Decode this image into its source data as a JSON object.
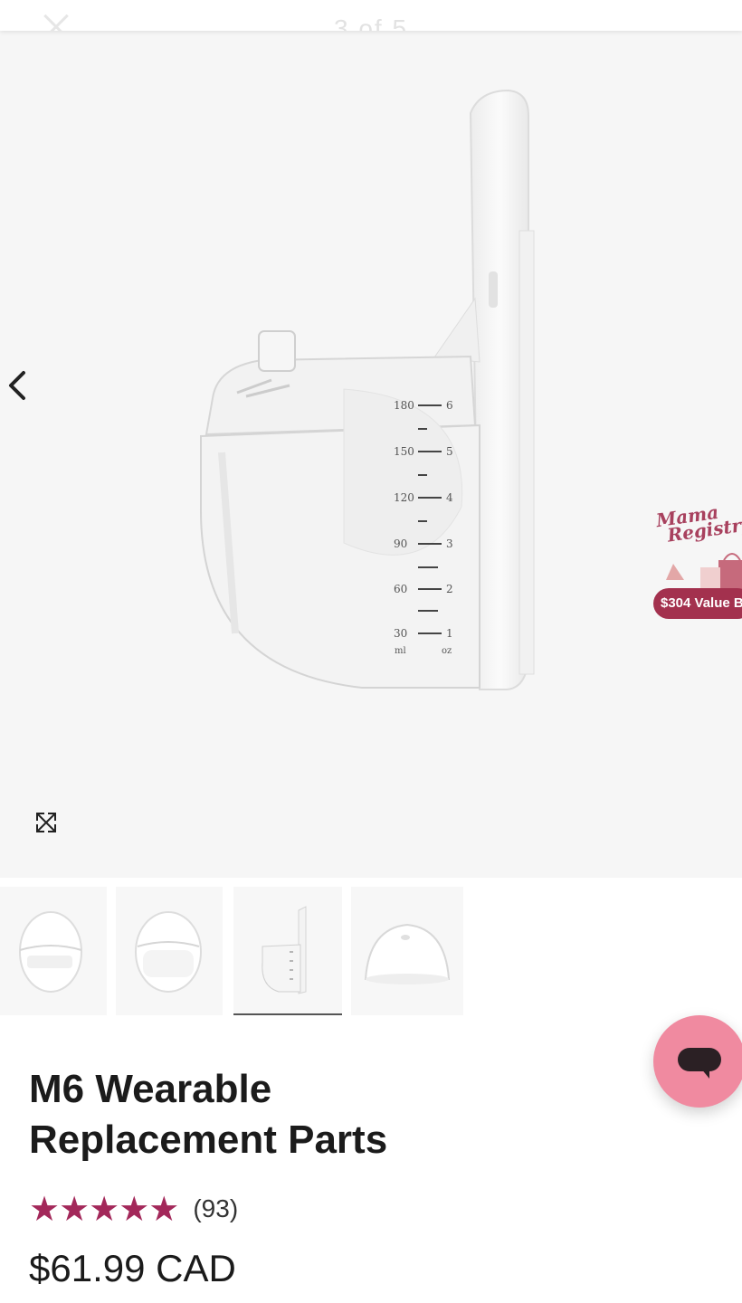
{
  "header": {
    "image_counter": "3 of 5"
  },
  "gallery": {
    "badge": {
      "line1": "Mama",
      "line2": "Registry",
      "pill": "$304 Value B"
    },
    "cup_scale": {
      "ml": [
        "180",
        "150",
        "120",
        "90",
        "60",
        "30"
      ],
      "oz": [
        "6",
        "5",
        "4",
        "3",
        "2",
        "1"
      ],
      "ml_unit": "ml",
      "oz_unit": "oz"
    },
    "thumbnails": [
      {
        "icon": "cup-front-thumbnail"
      },
      {
        "icon": "cup-front-thumbnail-2"
      },
      {
        "icon": "cup-side-thumbnail",
        "active": true
      },
      {
        "icon": "shield-dome-thumbnail"
      }
    ]
  },
  "product": {
    "title_line1": "M6 Wearable",
    "title_line2": "Replacement Parts",
    "stars": "★★★★★",
    "rating_value": 5,
    "review_count": "(93)",
    "price": "$61.99 CAD"
  },
  "colors": {
    "star": "#a3285a",
    "badge": "#a3314e",
    "chat_fab": "#f08aa0"
  }
}
